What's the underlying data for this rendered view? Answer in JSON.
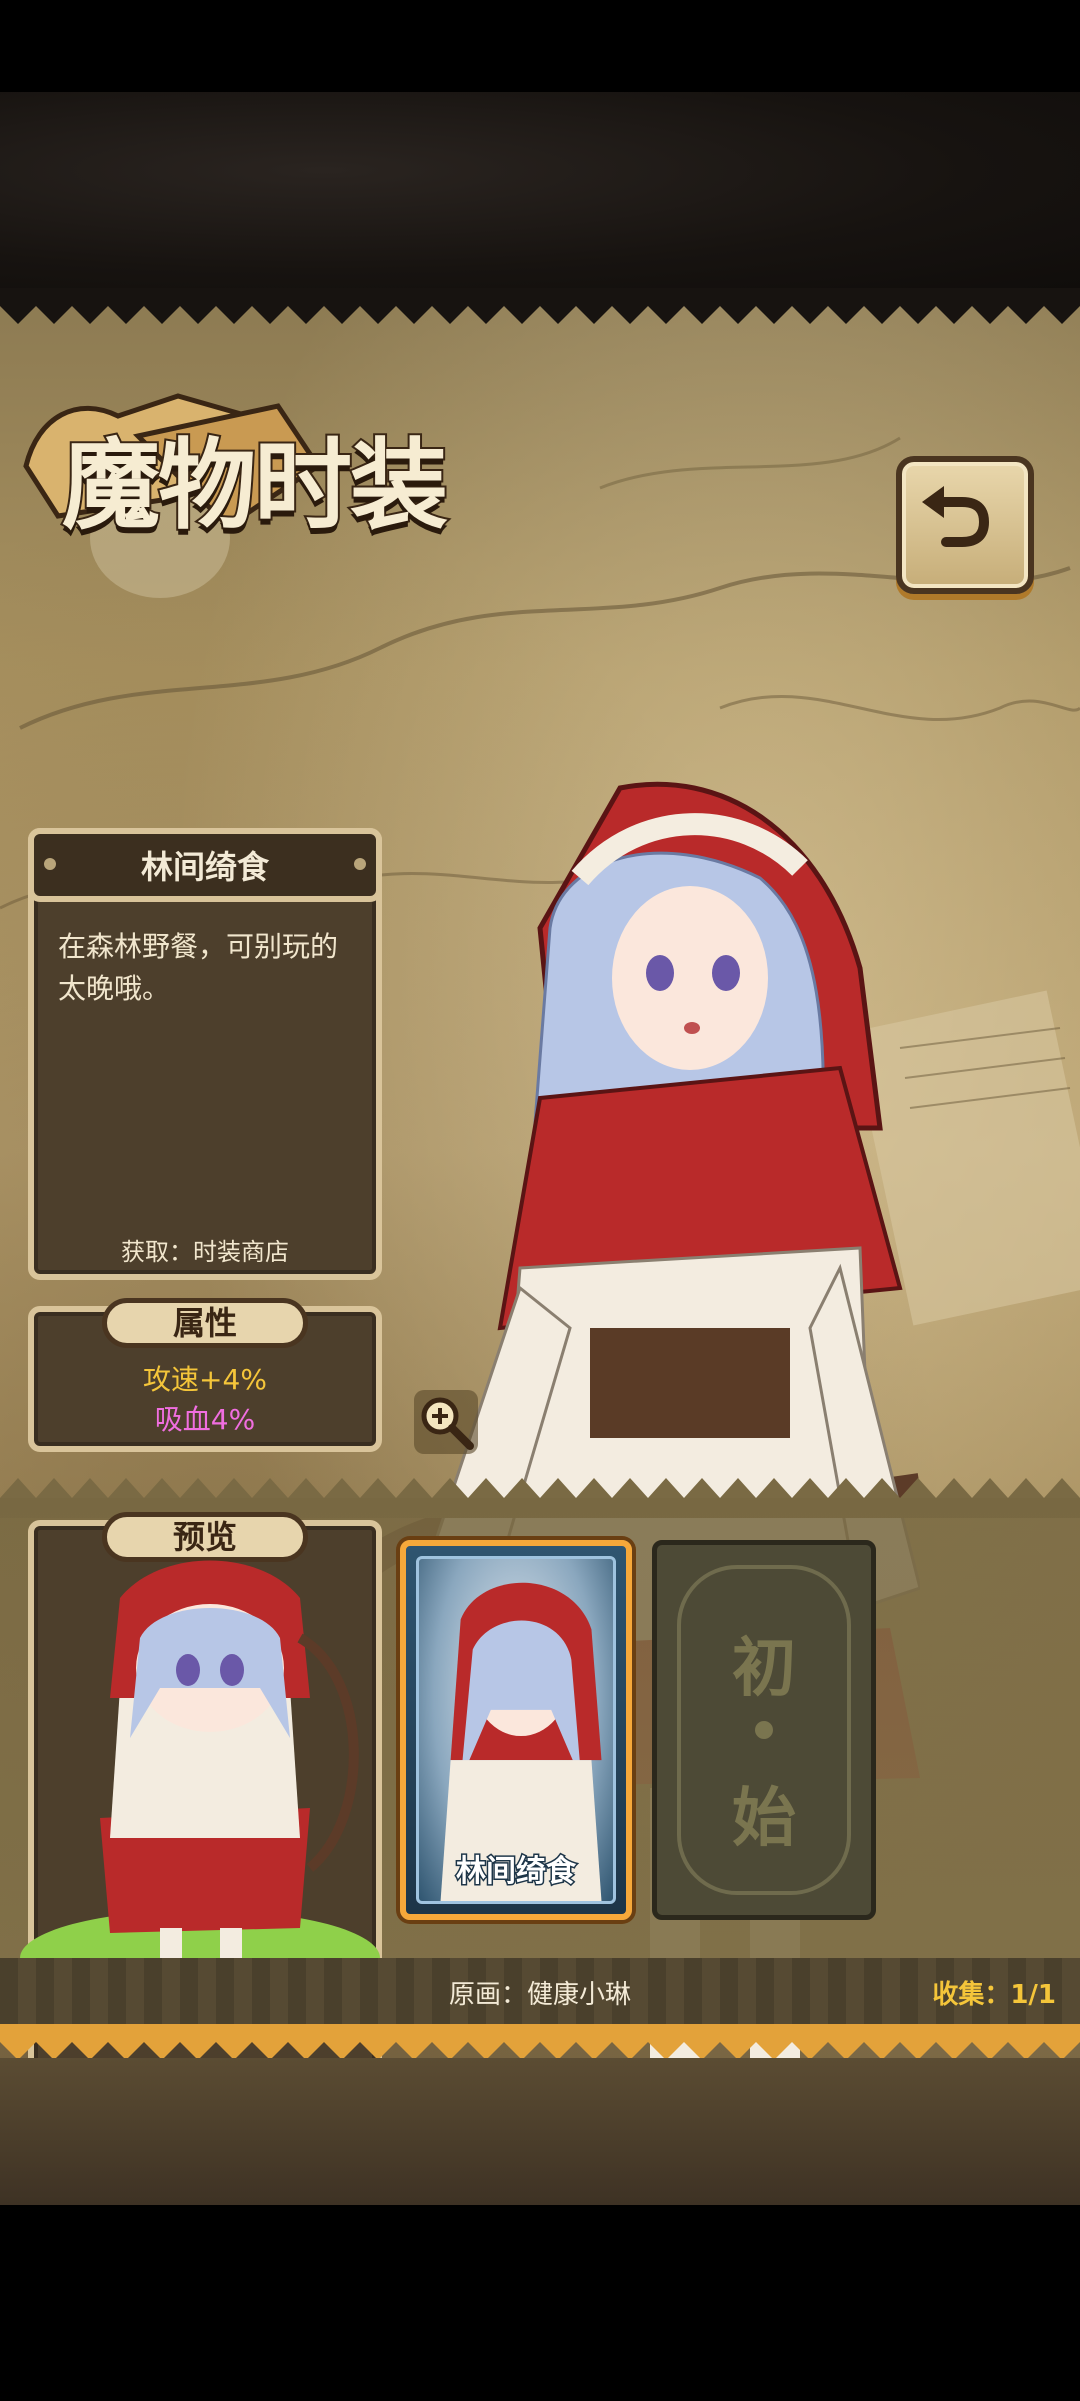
{
  "screen": {
    "title": "魔物时装",
    "back_icon": "return-arrow-icon"
  },
  "outfit": {
    "name": "林间绮食",
    "description": "在森林野餐，可别玩的太晚哦。",
    "obtain": "获取：时装商店"
  },
  "attributes": {
    "header": "属性",
    "items": [
      {
        "text": "攻速+4%",
        "color": "#f4c53a"
      },
      {
        "text": "吸血4%",
        "color": "#f06ee0"
      }
    ]
  },
  "preview": {
    "header": "预览",
    "zoom_icon": "magnify-plus-icon"
  },
  "cards": [
    {
      "label": "林间绮食",
      "selected": true
    },
    {
      "line1": "初",
      "line2": "始",
      "selected": false
    }
  ],
  "footer": {
    "artist": "原画：健康小琳",
    "collection": "收集：1/1"
  },
  "colors": {
    "accent_gold": "#f4c53a",
    "panel_bg": "#4d3f2c",
    "panel_border": "#d9c49a",
    "selected_card_border": "#f6a83a"
  }
}
